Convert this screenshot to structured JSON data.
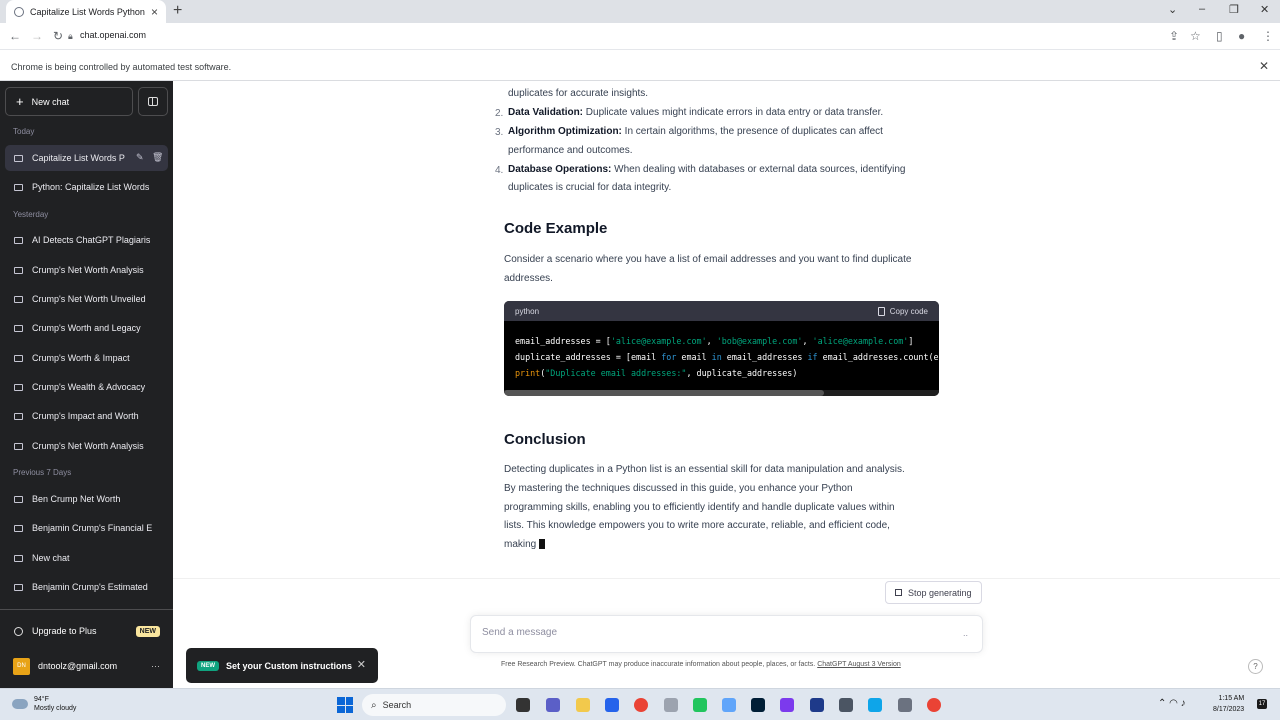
{
  "browser": {
    "tab_title": "Capitalize List Words Python",
    "url": "chat.openai.com",
    "infobar": "Chrome is being controlled by automated test software."
  },
  "sidebar": {
    "new_chat": "New chat",
    "sections": {
      "today": "Today",
      "yesterday": "Yesterday",
      "previous7": "Previous 7 Days"
    },
    "today_items": [
      "Capitalize List Words P",
      "Python: Capitalize List Words"
    ],
    "yesterday_items": [
      "AI Detects ChatGPT Plagiaris",
      "Crump's Net Worth Analysis",
      "Crump's Net Worth Unveiled",
      "Crump's Worth and Legacy",
      "Crump's Worth & Impact",
      "Crump's Wealth & Advocacy",
      "Crump's Impact and Worth",
      "Crump's Net Worth Analysis"
    ],
    "previous_items": [
      "Ben Crump Net Worth",
      "Benjamin Crump's Financial E",
      "New chat",
      "Benjamin Crump's Estimated"
    ],
    "upgrade": "Upgrade to Plus",
    "upgrade_badge": "NEW",
    "user_initials": "DN",
    "user_email": "dntoolz@gmail.com"
  },
  "content": {
    "line_top": "duplicates for accurate insights.",
    "list": [
      {
        "num": "2.",
        "bold": "Data Validation:",
        "text": " Duplicate values might indicate errors in data entry or data transfer."
      },
      {
        "num": "3.",
        "bold": "Algorithm Optimization:",
        "text": " In certain algorithms, the presence of duplicates can affect",
        "cont": "performance and outcomes."
      },
      {
        "num": "4.",
        "bold": "Database Operations:",
        "text": " When dealing with databases or external data sources, identifying",
        "cont": "duplicates is crucial for data integrity."
      }
    ],
    "code_heading": "Code Example",
    "code_intro_1": "Consider a scenario where you have a list of email addresses and you want to find duplicate",
    "code_intro_2": "addresses.",
    "code_lang": "python",
    "copy_label": "Copy code",
    "conclusion_heading": "Conclusion",
    "conclusion_lines": [
      "Detecting duplicates in a Python list is an essential skill for data manipulation and analysis.",
      "By mastering the techniques discussed in this guide, you enhance your Python",
      "programming skills, enabling you to efficiently identify and handle duplicate values within",
      "lists. This knowledge empowers you to write more accurate, reliable, and efficient code,",
      "making "
    ]
  },
  "composer": {
    "stop": "Stop generating",
    "placeholder": "Send a message",
    "send": "..",
    "footer_text": "Free Research Preview. ChatGPT may produce inaccurate information about people, places, or facts.",
    "footer_link": "ChatGPT August 3 Version",
    "help": "?"
  },
  "toast": {
    "badge": "NEW",
    "text": "Set your Custom instructions"
  },
  "taskbar": {
    "temp": "94°F",
    "weather": "Mostly cloudy",
    "search": "Search",
    "time": "1:15 AM",
    "date": "8/17/2023",
    "notif": "17"
  }
}
